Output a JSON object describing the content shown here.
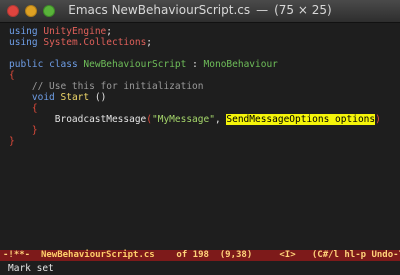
{
  "window": {
    "title_file": "Emacs NewBehaviourScript.cs",
    "title_sep": "—",
    "title_size": "(75 × 25)"
  },
  "code": {
    "l1_kw": "using",
    "l1_ns": "UnityEngine",
    "l1_end": ";",
    "l2_kw": "using",
    "l2_ns": "System.Collections",
    "l2_end": ";",
    "l4_kw1": "public",
    "l4_kw2": "class",
    "l4_class": "NewBehaviourScript",
    "l4_colon": " : ",
    "l4_base": "MonoBehaviour",
    "l5_brace": "{",
    "l6_comment": "// Use this for initialization",
    "l7_kw": "void",
    "l7_fn": "Start",
    "l7_parens": " ()",
    "l8_brace": "{",
    "l9_fn": "BroadcastMessage",
    "l9_paren": "(",
    "l9_str": "\"MyMessage\"",
    "l9_comma": ", ",
    "l9_hl": "SendMessageOptions options",
    "l9_close": ")",
    "l10_brace": "}",
    "l11_brace": "}"
  },
  "modeline": {
    "status": "-!**-  ",
    "buffer": "NewBehaviourScript.cs",
    "position": "    of 198  (9,38)     <I>   (C#/l hl-p Undo-Tree"
  },
  "minibuffer": {
    "message": "Mark set"
  },
  "colors": {
    "keyword": "#6f9fe8",
    "namespace": "#e0605a",
    "type": "#6fbf5a",
    "brace": "#e24b3b",
    "comment": "#9a9a9a",
    "string": "#a6d86b",
    "highlight": "#f5f50a",
    "modeline_bg": "#7d1a1a"
  }
}
